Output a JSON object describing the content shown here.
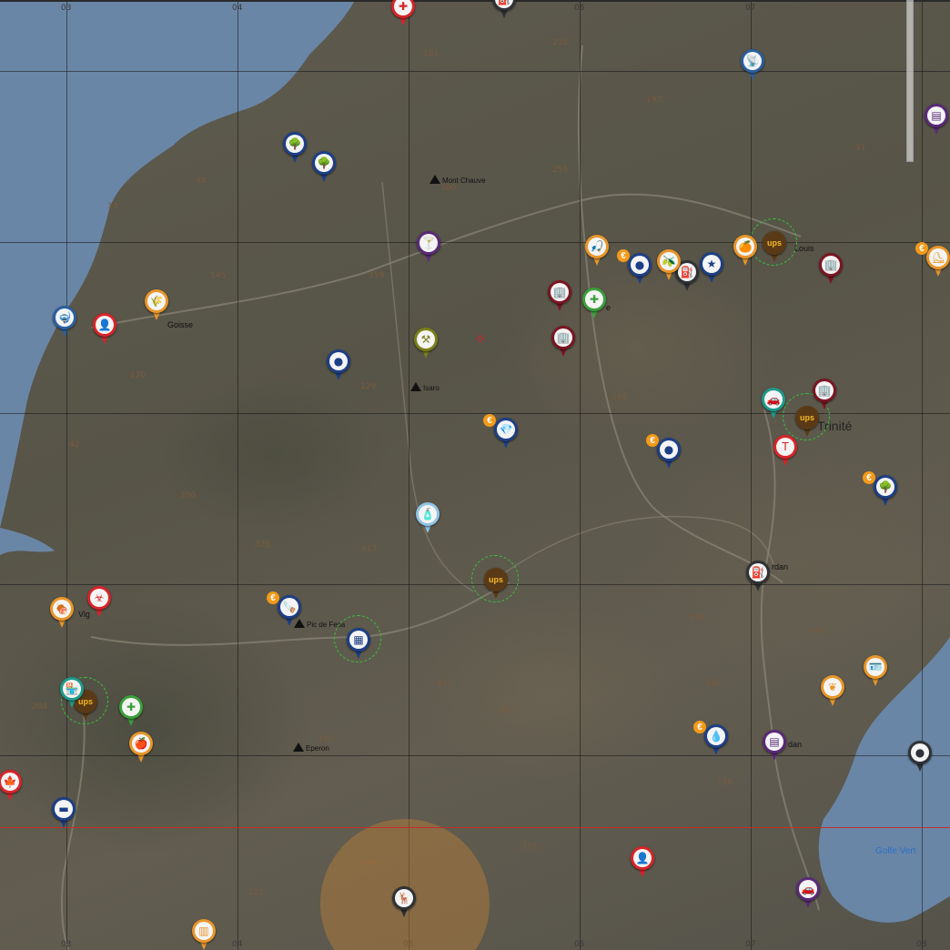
{
  "grid": {
    "column_labels": [
      "03",
      "04",
      "05",
      "06",
      "07",
      "08"
    ]
  },
  "places": {
    "mont_chauve": "Mont Chauve",
    "goisse": "Goisse",
    "isaro": "Isaro",
    "pic_de_fesa": "Pic de Fesa",
    "eperon": "Eperon",
    "vig": "Vig",
    "trinite": "Trinité",
    "jordan": "rdan",
    "dan": "dan",
    "st_louis": "Louis",
    "le": "e",
    "golfe_vert": "Golfe Vert"
  },
  "elevations": [
    "218",
    "181",
    "193",
    "91",
    "255",
    "380",
    "48",
    "18",
    "145",
    "359",
    "129",
    "258",
    "120",
    "390",
    "425",
    "417",
    "42",
    "204",
    "435",
    "421",
    "323",
    "168",
    "162",
    "182",
    "156",
    "373",
    "344",
    "323",
    "121",
    "193",
    "34",
    "24"
  ],
  "colors": {
    "water": "#6a86a6",
    "grid": "#141414",
    "red_line": "#c0302a",
    "zone": "#c48237",
    "ups_brown": "#5a3a16",
    "ups_gold": "#f7b924",
    "dark_red": "#7a1622",
    "red": "#d8242a",
    "navy": "#1d3f85",
    "orange": "#e8962a",
    "purple": "#5a2a78",
    "teal": "#1e9a8a",
    "green": "#3ba03a",
    "olive": "#7a7f18",
    "dark": "#2e3236",
    "lightblue": "#8fc3e6",
    "blue": "#2a5f9e"
  },
  "markers": [
    {
      "id": "gas-station",
      "icon": "gas-pump-icon",
      "glyph": "⛽",
      "color": "dark"
    },
    {
      "id": "radio-tower",
      "icon": "antenna-icon",
      "glyph": "📡",
      "color": "blue"
    },
    {
      "id": "hospital-top",
      "icon": "medical-icon",
      "glyph": "✚",
      "color": "red"
    },
    {
      "id": "tree-1",
      "icon": "tree-icon",
      "glyph": "🌳",
      "color": "navy"
    },
    {
      "id": "tree-2",
      "icon": "tree-icon",
      "glyph": "🌳",
      "color": "navy"
    },
    {
      "id": "cocktail",
      "icon": "cocktail-icon",
      "glyph": "🍸",
      "color": "purple"
    },
    {
      "id": "wheat",
      "icon": "wheat-icon",
      "glyph": "🌾",
      "color": "orange"
    },
    {
      "id": "diver",
      "icon": "diving-mask-icon",
      "glyph": "🤿",
      "color": "blue"
    },
    {
      "id": "rebel",
      "icon": "hooded-figure-icon",
      "glyph": "👤",
      "color": "red"
    },
    {
      "id": "mining",
      "icon": "pickaxe-icon",
      "glyph": "⚒",
      "color": "olive"
    },
    {
      "id": "coal",
      "icon": "coal-icon",
      "glyph": "●",
      "color": "navy"
    },
    {
      "id": "diamond",
      "icon": "diamond-icon",
      "glyph": "💎",
      "color": "navy"
    },
    {
      "id": "water-bottle",
      "icon": "bottle-icon",
      "glyph": "🧴",
      "color": "lightblue"
    },
    {
      "id": "ups-center",
      "icon": "ups-icon",
      "glyph": "ups",
      "color": "ups_brown"
    },
    {
      "id": "ups-trinite",
      "icon": "ups-icon",
      "glyph": "ups",
      "color": "ups_brown"
    },
    {
      "id": "ups-stlouis",
      "icon": "ups-icon",
      "glyph": "ups",
      "color": "ups_brown"
    },
    {
      "id": "ups-vig",
      "icon": "ups-icon",
      "glyph": "ups",
      "color": "ups_brown"
    },
    {
      "id": "pharmacy",
      "icon": "medical-cross-icon",
      "glyph": "✚",
      "color": "green"
    },
    {
      "id": "building-1",
      "icon": "building-icon",
      "glyph": "🏢",
      "color": "dark_red"
    },
    {
      "id": "building-2",
      "icon": "building-icon",
      "glyph": "🏢",
      "color": "dark_red"
    },
    {
      "id": "building-3",
      "icon": "building-icon",
      "glyph": "🏢",
      "color": "dark_red"
    },
    {
      "id": "building-4",
      "icon": "building-icon",
      "glyph": "🏢",
      "color": "dark_red"
    },
    {
      "id": "tesla",
      "icon": "tesla-icon",
      "glyph": "T",
      "color": "red"
    },
    {
      "id": "car-dealer",
      "icon": "car-icon",
      "glyph": "🚗",
      "color": "teal"
    },
    {
      "id": "police",
      "icon": "star-badge-icon",
      "glyph": "★",
      "color": "navy"
    },
    {
      "id": "gas-stlouis",
      "icon": "gas-pump-icon",
      "glyph": "⛽",
      "color": "dark"
    },
    {
      "id": "fruit",
      "icon": "fruit-icon",
      "glyph": "🍊",
      "color": "orange"
    },
    {
      "id": "olive",
      "icon": "olive-icon",
      "glyph": "🫒",
      "color": "orange"
    },
    {
      "id": "fishing",
      "icon": "fishing-icon",
      "glyph": "🎣",
      "color": "orange"
    },
    {
      "id": "rock-1",
      "icon": "rock-icon",
      "glyph": "●",
      "color": "navy"
    },
    {
      "id": "rock-2",
      "icon": "rock-icon",
      "glyph": "●",
      "color": "navy"
    },
    {
      "id": "tree-east",
      "icon": "tree-icon",
      "glyph": "🌳",
      "color": "navy"
    },
    {
      "id": "gas-jordan",
      "icon": "gas-pump-icon",
      "glyph": "⛽",
      "color": "dark"
    },
    {
      "id": "meat",
      "icon": "meat-icon",
      "glyph": "🍖",
      "color": "orange"
    },
    {
      "id": "biohazard",
      "icon": "biohazard-icon",
      "glyph": "☣",
      "color": "red"
    },
    {
      "id": "shop-vig",
      "icon": "shop-icon",
      "glyph": "🏪",
      "color": "teal"
    },
    {
      "id": "pharmacy-vig",
      "icon": "medical-cross-icon",
      "glyph": "✚",
      "color": "green"
    },
    {
      "id": "apple",
      "icon": "apple-icon",
      "glyph": "🍎",
      "color": "orange"
    },
    {
      "id": "cannabis",
      "icon": "leaf-icon",
      "glyph": "🍁",
      "color": "red"
    },
    {
      "id": "iron",
      "icon": "iron-bar-icon",
      "glyph": "▬",
      "color": "navy"
    },
    {
      "id": "sawmill",
      "icon": "saw-icon",
      "glyph": "🪚",
      "color": "navy"
    },
    {
      "id": "solar",
      "icon": "solar-panel-icon",
      "glyph": "▦",
      "color": "navy"
    },
    {
      "id": "oil",
      "icon": "oil-drop-icon",
      "glyph": "💧",
      "color": "navy"
    },
    {
      "id": "hops",
      "icon": "hops-icon",
      "glyph": "❦",
      "color": "orange"
    },
    {
      "id": "license",
      "icon": "license-icon",
      "glyph": "🪪",
      "color": "orange"
    },
    {
      "id": "atm",
      "icon": "atm-icon",
      "glyph": "▤",
      "color": "purple"
    },
    {
      "id": "crystal-east",
      "icon": "rock-icon",
      "glyph": "●",
      "color": "dark"
    },
    {
      "id": "rebel-south",
      "icon": "hooded-figure-icon",
      "glyph": "👤",
      "color": "red"
    },
    {
      "id": "deer",
      "icon": "deer-icon",
      "glyph": "🦌",
      "color": "dark"
    },
    {
      "id": "garage",
      "icon": "car-icon",
      "glyph": "🚗",
      "color": "purple"
    },
    {
      "id": "gold-bars",
      "icon": "gold-bars-icon",
      "glyph": "▥",
      "color": "orange"
    },
    {
      "id": "atm-top",
      "icon": "atm-icon",
      "glyph": "▤",
      "color": "purple"
    },
    {
      "id": "skate",
      "icon": "shoe-icon",
      "glyph": "⛸",
      "color": "orange"
    }
  ]
}
